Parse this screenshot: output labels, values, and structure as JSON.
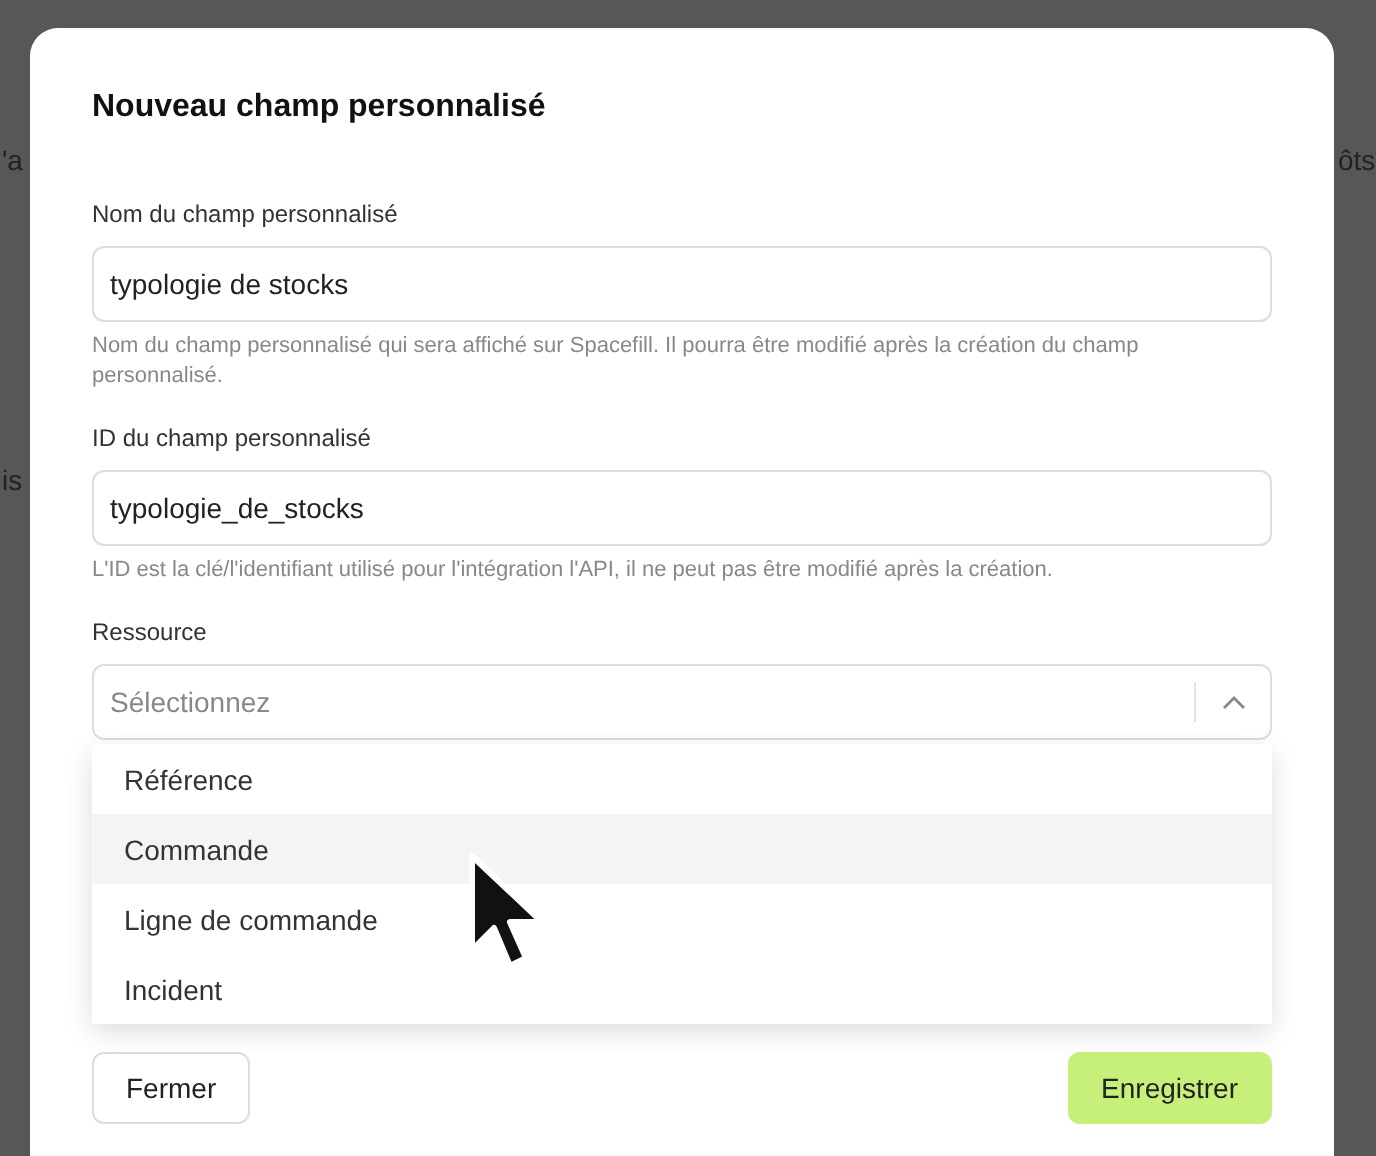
{
  "background": {
    "texts": [
      "'a",
      "ôts",
      "is"
    ]
  },
  "dialog": {
    "title": "Nouveau champ personnalisé",
    "fields": [
      {
        "label": "Nom du champ personnalisé",
        "value": "typologie de stocks",
        "help": "Nom du champ personnalisé qui sera affiché sur Spacefill. Il pourra être modifié après la création du champ personnalisé."
      },
      {
        "label": "ID du champ personnalisé",
        "value": "typologie_de_stocks",
        "help": "L'ID est la clé/l'identifiant utilisé pour l'intégration l'API, il ne peut pas être modifié après la création."
      }
    ],
    "select": {
      "label": "Ressource",
      "placeholder": "Sélectionnez",
      "expanded": true,
      "options": [
        {
          "label": "Référence",
          "selected": false
        },
        {
          "label": "Commande",
          "selected": true
        },
        {
          "label": "Ligne de commande",
          "selected": false
        },
        {
          "label": "Incident",
          "selected": false
        }
      ]
    },
    "buttons": [
      {
        "label": "Fermer",
        "kind": "secondary"
      },
      {
        "label": "Enregistrer",
        "kind": "primary"
      }
    ]
  }
}
